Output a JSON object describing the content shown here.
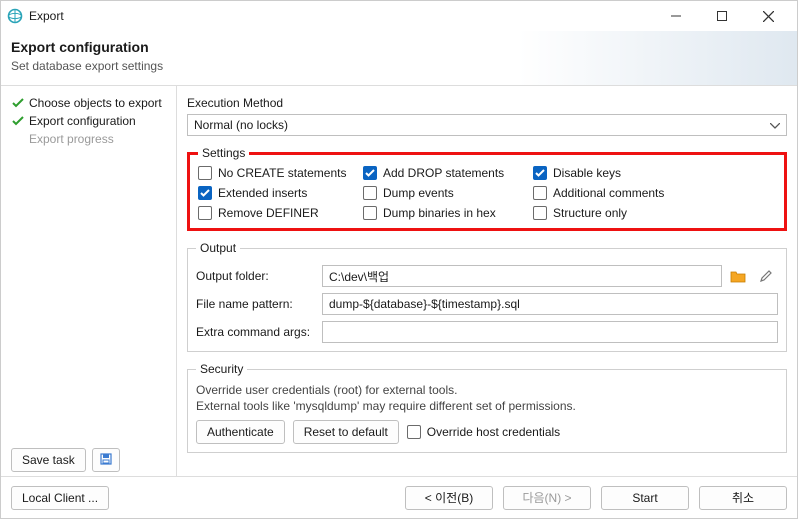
{
  "titlebar": {
    "title": "Export"
  },
  "header": {
    "title": "Export configuration",
    "subtitle": "Set database export settings"
  },
  "steps": {
    "items": [
      {
        "label": "Choose objects to export",
        "done": true
      },
      {
        "label": "Export configuration",
        "done": true
      },
      {
        "label": "Export progress",
        "done": false
      }
    ]
  },
  "execMethod": {
    "label": "Execution Method",
    "value": "Normal (no locks)"
  },
  "settings": {
    "legend": "Settings",
    "items": [
      {
        "label": "No CREATE statements",
        "checked": false
      },
      {
        "label": "Add DROP statements",
        "checked": true
      },
      {
        "label": "Disable keys",
        "checked": true
      },
      {
        "label": "Extended inserts",
        "checked": true
      },
      {
        "label": "Dump events",
        "checked": false
      },
      {
        "label": "Additional comments",
        "checked": false
      },
      {
        "label": "Remove DEFINER",
        "checked": false
      },
      {
        "label": "Dump binaries in hex",
        "checked": false
      },
      {
        "label": "Structure only",
        "checked": false
      }
    ]
  },
  "output": {
    "legend": "Output",
    "folder_label": "Output folder:",
    "folder_value": "C:\\dev\\백업",
    "pattern_label": "File name pattern:",
    "pattern_value": "dump-${database}-${timestamp}.sql",
    "extra_label": "Extra command args:",
    "extra_value": ""
  },
  "security": {
    "legend": "Security",
    "note1": "Override user credentials (root) for external tools.",
    "note2": "External tools like 'mysqldump' may require different set of permissions.",
    "auth_btn": "Authenticate",
    "reset_btn": "Reset to default",
    "override_label": "Override host credentials",
    "override_checked": false
  },
  "bottom": {
    "save_task": "Save task"
  },
  "footer": {
    "local_client": "Local Client ...",
    "back": "< 이전(B)",
    "next": "다음(N) >",
    "start": "Start",
    "cancel": "취소"
  }
}
